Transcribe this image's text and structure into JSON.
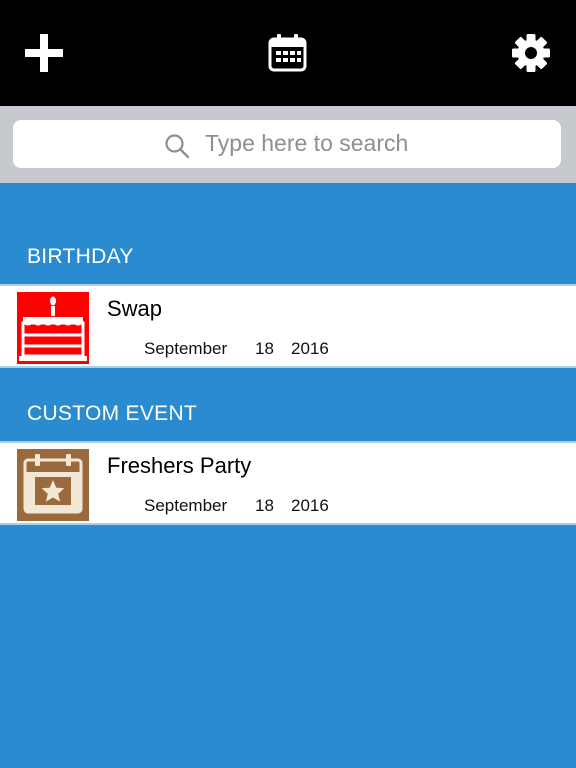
{
  "toolbar": {
    "add_icon": "plus-icon",
    "calendar_icon": "calendar-icon",
    "settings_icon": "gear-icon",
    "background": "#000000"
  },
  "search": {
    "placeholder": "Type here to search",
    "icon": "search-icon"
  },
  "sections": [
    {
      "header": "BIRTHDAY",
      "items": [
        {
          "title": "Swap",
          "month": "September",
          "day": "18",
          "year": "2016",
          "icon": "birthday-cake-icon",
          "icon_color": "#ff0000"
        }
      ]
    },
    {
      "header": "CUSTOM EVENT",
      "items": [
        {
          "title": "Freshers Party",
          "month": "September",
          "day": "18",
          "year": "2016",
          "icon": "star-calendar-icon",
          "icon_color": "#9b6a3c"
        }
      ]
    }
  ],
  "colors": {
    "background": "#2b8bd0",
    "search_bar": "#c6c9cd"
  }
}
